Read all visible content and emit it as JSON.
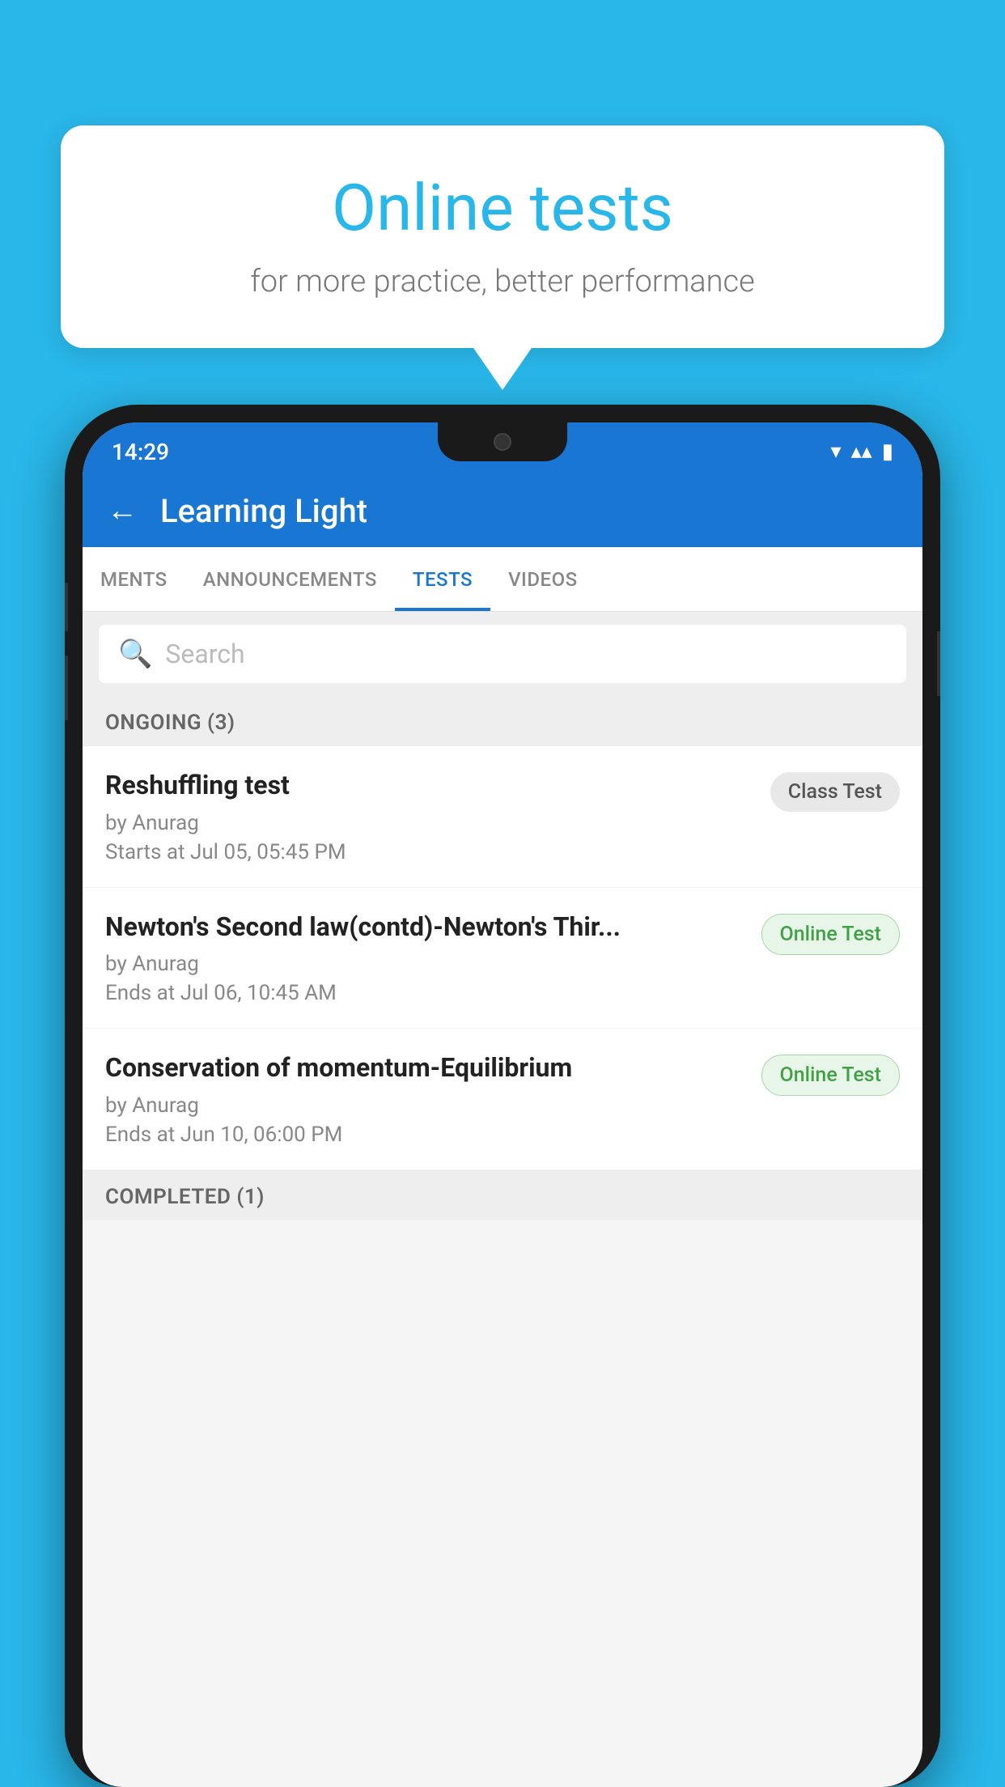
{
  "background_color": "#29b6e8",
  "speech_bubble": {
    "title": "Online tests",
    "subtitle": "for more practice, better performance"
  },
  "status_bar": {
    "time": "14:29",
    "wifi": "▾",
    "signal": "▾",
    "battery": "▮"
  },
  "app_header": {
    "back_label": "←",
    "title": "Learning Light"
  },
  "tabs": [
    {
      "label": "MENTS",
      "active": false
    },
    {
      "label": "ANNOUNCEMENTS",
      "active": false
    },
    {
      "label": "TESTS",
      "active": true
    },
    {
      "label": "VIDEOS",
      "active": false
    }
  ],
  "search": {
    "placeholder": "Search"
  },
  "ongoing_section": {
    "header": "ONGOING (3)",
    "tests": [
      {
        "name": "Reshuffling test",
        "by": "by Anurag",
        "date": "Starts at  Jul 05, 05:45 PM",
        "badge_label": "Class Test",
        "badge_type": "class"
      },
      {
        "name": "Newton's Second law(contd)-Newton's Thir...",
        "by": "by Anurag",
        "date": "Ends at  Jul 06, 10:45 AM",
        "badge_label": "Online Test",
        "badge_type": "online"
      },
      {
        "name": "Conservation of momentum-Equilibrium",
        "by": "by Anurag",
        "date": "Ends at  Jun 10, 06:00 PM",
        "badge_label": "Online Test",
        "badge_type": "online"
      }
    ]
  },
  "completed_section": {
    "header": "COMPLETED (1)"
  }
}
